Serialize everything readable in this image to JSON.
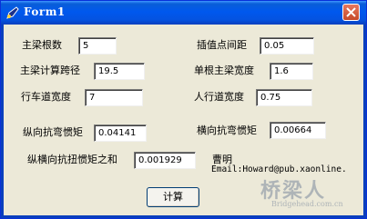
{
  "window": {
    "title": "Form1"
  },
  "fields": {
    "main_beam_count": {
      "label": "主梁根数",
      "value": "5"
    },
    "interp_spacing": {
      "label": "插值点间距",
      "value": "0.05"
    },
    "main_beam_span": {
      "label": "主梁计算跨径",
      "value": "19.5"
    },
    "single_beam_width": {
      "label": "单根主梁宽度",
      "value": "1.6"
    },
    "lane_width": {
      "label": "行车道宽度",
      "value": "7"
    },
    "sidewalk_width": {
      "label": "人行道宽度",
      "value": "0.75"
    },
    "long_bending_inertia": {
      "label": "纵向抗弯惯矩",
      "value": "0.04141"
    },
    "trans_bending_inertia": {
      "label": "横向抗弯惯矩",
      "value": "0.00664"
    },
    "torsion_sum": {
      "label": "纵横向抗扭惯矩之和",
      "value": "0.001929"
    }
  },
  "author": {
    "name": "曹明",
    "email": "Email:Howard@pub.xaonline."
  },
  "buttons": {
    "calculate": "计算"
  },
  "watermark": {
    "text": "桥梁人",
    "url": "Bridgehead.com.cn"
  }
}
